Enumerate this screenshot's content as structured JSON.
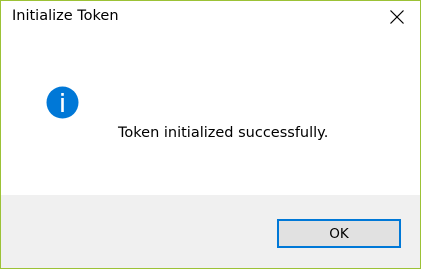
{
  "dialog": {
    "title": "Initialize Token",
    "message": "Token initialized successfully.",
    "ok_label": "OK",
    "icon": "info-icon",
    "accent_color": "#0078d7",
    "border_color": "#9cc236"
  }
}
